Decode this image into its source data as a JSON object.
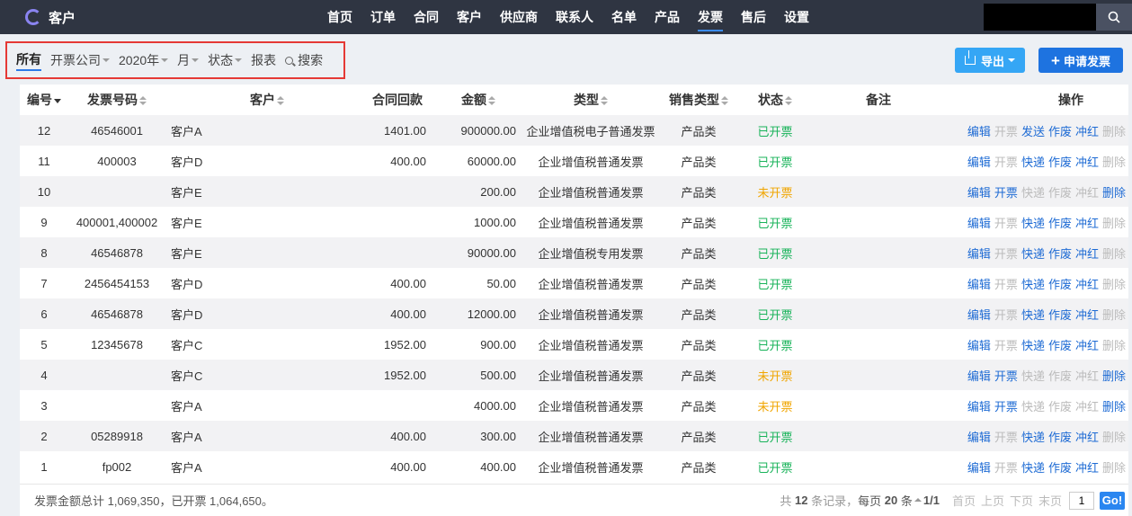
{
  "brand": {
    "name": "客户"
  },
  "nav": [
    "首页",
    "订单",
    "合同",
    "客户",
    "供应商",
    "联系人",
    "名单",
    "产品",
    "发票",
    "售后",
    "设置"
  ],
  "nav_active": "发票",
  "search": {
    "value": "",
    "icon": "search-icon"
  },
  "filters": {
    "all": "所有",
    "company": "开票公司",
    "year": "2020年",
    "month": "月",
    "status": "状态",
    "report": "报表",
    "search": "搜索"
  },
  "buttons": {
    "export": "导出",
    "apply": "申请发票"
  },
  "columns": [
    "编号",
    "发票号码",
    "客户",
    "合同回款",
    "金额",
    "类型",
    "销售类型",
    "状态",
    "备注",
    "操作"
  ],
  "rows": [
    {
      "id": "12",
      "invoice_no": "46546001",
      "customer": "客户A",
      "contract_payment": "1401.00",
      "amount": "900000.00",
      "type": "企业增值税电子普通发票",
      "sales_type": "产品类",
      "status": "已开票",
      "remark": "",
      "ops": [
        "编辑",
        "开票",
        "发送",
        "作废",
        "冲红",
        "删除"
      ]
    },
    {
      "id": "11",
      "invoice_no": "400003",
      "customer": "客户D",
      "contract_payment": "400.00",
      "amount": "60000.00",
      "type": "企业增值税普通发票",
      "sales_type": "产品类",
      "status": "已开票",
      "remark": "",
      "ops": [
        "编辑",
        "开票",
        "快递",
        "作废",
        "冲红",
        "删除"
      ]
    },
    {
      "id": "10",
      "invoice_no": "",
      "customer": "客户E",
      "contract_payment": "",
      "amount": "200.00",
      "type": "企业增值税普通发票",
      "sales_type": "产品类",
      "status": "未开票",
      "remark": "",
      "ops": [
        "编辑",
        "开票",
        "快递",
        "作废",
        "冲红",
        "删除"
      ]
    },
    {
      "id": "9",
      "invoice_no": "400001,400002",
      "customer": "客户E",
      "contract_payment": "",
      "amount": "1000.00",
      "type": "企业增值税普通发票",
      "sales_type": "产品类",
      "status": "已开票",
      "remark": "",
      "ops": [
        "编辑",
        "开票",
        "快递",
        "作废",
        "冲红",
        "删除"
      ]
    },
    {
      "id": "8",
      "invoice_no": "46546878",
      "customer": "客户E",
      "contract_payment": "",
      "amount": "90000.00",
      "type": "企业增值税专用发票",
      "sales_type": "产品类",
      "status": "已开票",
      "remark": "",
      "ops": [
        "编辑",
        "开票",
        "快递",
        "作废",
        "冲红",
        "删除"
      ]
    },
    {
      "id": "7",
      "invoice_no": "2456454153",
      "customer": "客户D",
      "contract_payment": "400.00",
      "amount": "50.00",
      "type": "企业增值税普通发票",
      "sales_type": "产品类",
      "status": "已开票",
      "remark": "",
      "ops": [
        "编辑",
        "开票",
        "快递",
        "作废",
        "冲红",
        "删除"
      ]
    },
    {
      "id": "6",
      "invoice_no": "46546878",
      "customer": "客户D",
      "contract_payment": "400.00",
      "amount": "12000.00",
      "type": "企业增值税普通发票",
      "sales_type": "产品类",
      "status": "已开票",
      "remark": "",
      "ops": [
        "编辑",
        "开票",
        "快递",
        "作废",
        "冲红",
        "删除"
      ]
    },
    {
      "id": "5",
      "invoice_no": "12345678",
      "customer": "客户C",
      "contract_payment": "1952.00",
      "amount": "900.00",
      "type": "企业增值税普通发票",
      "sales_type": "产品类",
      "status": "已开票",
      "remark": "",
      "ops": [
        "编辑",
        "开票",
        "快递",
        "作废",
        "冲红",
        "删除"
      ]
    },
    {
      "id": "4",
      "invoice_no": "",
      "customer": "客户C",
      "contract_payment": "1952.00",
      "amount": "500.00",
      "type": "企业增值税普通发票",
      "sales_type": "产品类",
      "status": "未开票",
      "remark": "",
      "ops": [
        "编辑",
        "开票",
        "快递",
        "作废",
        "冲红",
        "删除"
      ]
    },
    {
      "id": "3",
      "invoice_no": "",
      "customer": "客户A",
      "contract_payment": "",
      "amount": "4000.00",
      "type": "企业增值税普通发票",
      "sales_type": "产品类",
      "status": "未开票",
      "remark": "",
      "ops": [
        "编辑",
        "开票",
        "快递",
        "作废",
        "冲红",
        "删除"
      ]
    },
    {
      "id": "2",
      "invoice_no": "05289918",
      "customer": "客户A",
      "contract_payment": "400.00",
      "amount": "300.00",
      "type": "企业增值税普通发票",
      "sales_type": "产品类",
      "status": "已开票",
      "remark": "",
      "ops": [
        "编辑",
        "开票",
        "快递",
        "作废",
        "冲红",
        "删除"
      ]
    },
    {
      "id": "1",
      "invoice_no": "fp002",
      "customer": "客户A",
      "contract_payment": "400.00",
      "amount": "400.00",
      "type": "企业增值税普通发票",
      "sales_type": "产品类",
      "status": "已开票",
      "remark": "",
      "ops": [
        "编辑",
        "开票",
        "快递",
        "作废",
        "冲红",
        "删除"
      ]
    }
  ],
  "footer": {
    "summary": "发票金额总计 1,069,350，已开票 1,064,650。",
    "total_prefix": "共",
    "total": "12",
    "total_suffix": "条记录，",
    "per_page_prefix": "每页",
    "per_page": "20",
    "per_page_suffix": "条",
    "page": "1/1",
    "first": "首页",
    "prev": "上页",
    "next": "下页",
    "last": "末页",
    "page_input": "1",
    "go": "Go!"
  },
  "colors": {
    "topbar": "#2f3542",
    "done": "#19b35a",
    "pending": "#f0a500",
    "link": "#1e6bd4",
    "disabled": "#bbbbbb",
    "highlight": "#e53935"
  }
}
